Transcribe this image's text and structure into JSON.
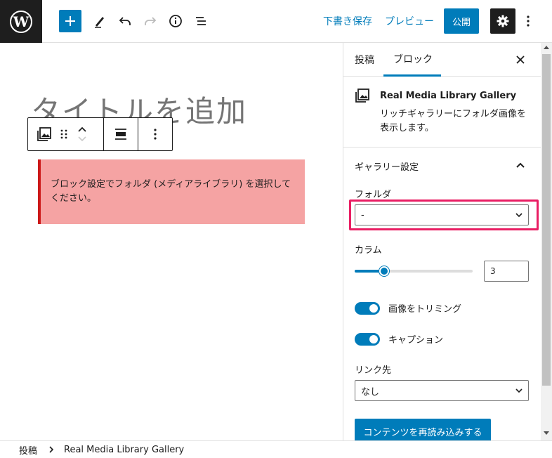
{
  "topbar": {
    "save_draft": "下書き保存",
    "preview": "プレビュー",
    "publish": "公開"
  },
  "editor": {
    "title_placeholder": "タイトルを追加",
    "notice": "ブロック設定でフォルダ (メディアライブラリ) を選択してください。"
  },
  "sidebar": {
    "tabs": [
      {
        "label": "投稿"
      },
      {
        "label": "ブロック"
      }
    ],
    "block": {
      "title": "Real Media Library Gallery",
      "description": "リッチギャラリーにフォルダ画像を表示します。"
    },
    "panel": {
      "title": "ギャラリー設定",
      "folder_label": "フォルダ",
      "folder_value": "-",
      "columns_label": "カラム",
      "columns_value": "3",
      "columns_min": 1,
      "columns_max": 9,
      "crop_label": "画像をトリミング",
      "crop_on": true,
      "caption_label": "キャプション",
      "caption_on": true,
      "link_label": "リンク先",
      "link_value": "なし",
      "reload_button": "コンテンツを再読み込みする"
    }
  },
  "breadcrumb": {
    "items": [
      "投稿",
      "Real Media Library Gallery"
    ]
  },
  "colors": {
    "accent": "#007cba",
    "notice_bg": "#f5a3a3",
    "notice_border": "#cc1818",
    "highlight": "#e91e63"
  }
}
